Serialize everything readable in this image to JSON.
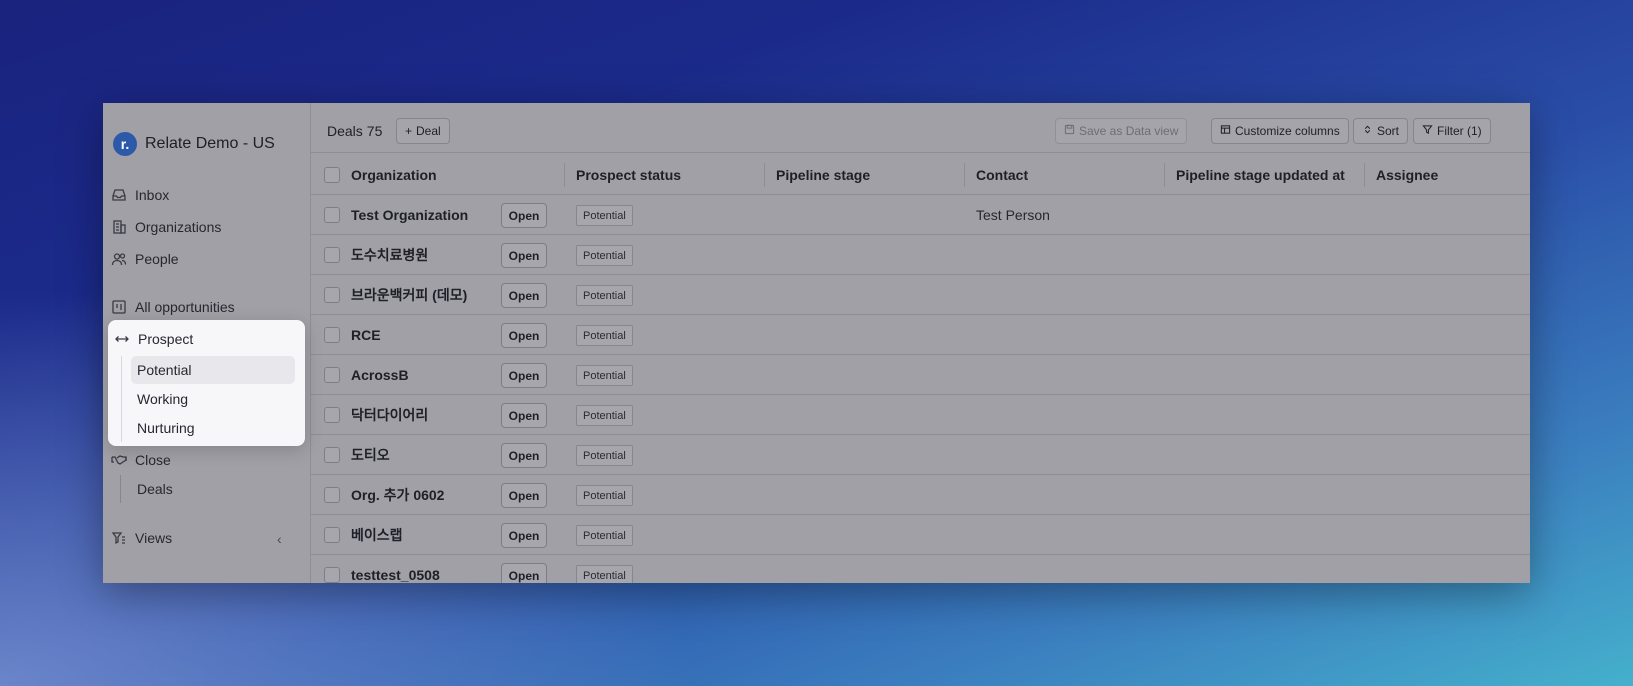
{
  "brand": {
    "logo_letter": "r.",
    "name": "Relate Demo - US"
  },
  "sidebar": {
    "primary": [
      {
        "label": "Inbox",
        "icon": "inbox-icon"
      },
      {
        "label": "Organizations",
        "icon": "building-icon"
      },
      {
        "label": "People",
        "icon": "people-icon"
      }
    ],
    "all_opportunities": {
      "label": "All opportunities",
      "icon": "kanban-icon"
    },
    "close": {
      "label": "Close",
      "icon": "handshake-icon",
      "items": [
        "Deals"
      ]
    },
    "views": {
      "label": "Views",
      "icon": "filter-list-icon",
      "chevron": "‹"
    }
  },
  "popout": {
    "label": "Prospect",
    "icon": "arrows-horizontal-icon",
    "items": [
      "Potential",
      "Working",
      "Nurturing"
    ],
    "active": "Potential"
  },
  "toolbar": {
    "title": "Deals",
    "count": "75",
    "add_deal": "Deal",
    "save_view": "Save as Data view",
    "customize": "Customize columns",
    "sort": "Sort",
    "filter": "Filter (1)"
  },
  "table": {
    "columns": [
      "Organization",
      "Prospect status",
      "Pipeline stage",
      "Contact",
      "Pipeline stage updated at",
      "Assignee"
    ],
    "open_label": "Open",
    "rows": [
      {
        "org": "Test Organization",
        "status": "Potential",
        "contact": "Test Person"
      },
      {
        "org": "도수치료병원",
        "status": "Potential",
        "contact": ""
      },
      {
        "org": "브라운백커피 (데모)",
        "status": "Potential",
        "contact": ""
      },
      {
        "org": "RCE",
        "status": "Potential",
        "contact": ""
      },
      {
        "org": "AcrossB",
        "status": "Potential",
        "contact": ""
      },
      {
        "org": "닥터다이어리",
        "status": "Potential",
        "contact": ""
      },
      {
        "org": "도티오",
        "status": "Potential",
        "contact": ""
      },
      {
        "org": "Org. 추가 0602",
        "status": "Potential",
        "contact": ""
      },
      {
        "org": "베이스랩",
        "status": "Potential",
        "contact": ""
      },
      {
        "org": "testtest_0508",
        "status": "Potential",
        "contact": ""
      }
    ]
  }
}
